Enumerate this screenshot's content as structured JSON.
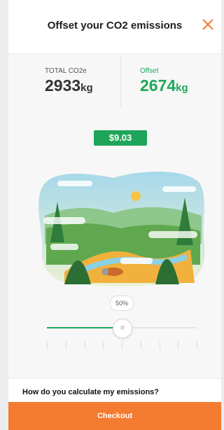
{
  "header": {
    "title": "Offset your CO2 emissions"
  },
  "stats": {
    "total": {
      "label": "TOTAL CO2e",
      "value": "2933",
      "unit": "kg"
    },
    "offset": {
      "label": "Offset",
      "value": "2674",
      "unit": "kg"
    }
  },
  "price": "$9.03",
  "slider": {
    "percent_label": "50%",
    "value": 0.5,
    "thumb_glyph": "#"
  },
  "faq": {
    "question": "How do you calculate my emissions?"
  },
  "checkout": {
    "label": "Checkout"
  },
  "colors": {
    "accent_green": "#1ea85a",
    "checkout_orange": "#f47c30",
    "close_orange": "#f47c30"
  }
}
